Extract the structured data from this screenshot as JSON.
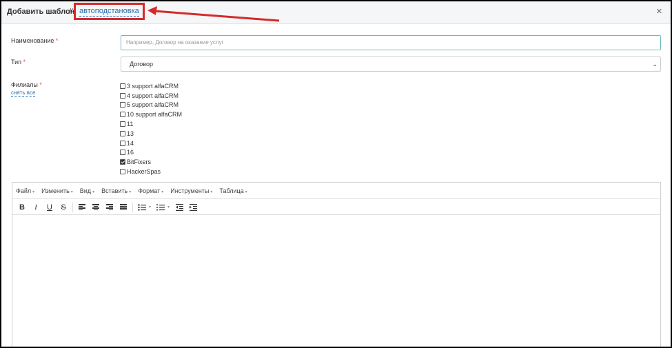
{
  "header": {
    "title": "Добавить шаблон",
    "separator": "//",
    "autofill_link": "автоподстановка",
    "close": "×"
  },
  "form": {
    "name_label": "Наименование",
    "required_mark": "*",
    "name_placeholder": "Например, Договор на оказание услуг",
    "type_label": "Тип",
    "type_value": "Договор",
    "branches_label": "Филиалы",
    "uncheck_all": "снять все",
    "branches": [
      {
        "label": "3 support alfaCRM",
        "checked": false
      },
      {
        "label": "4 support alfaCRM",
        "checked": false
      },
      {
        "label": "5 support alfaCRM",
        "checked": false
      },
      {
        "label": "10 support alfaCRM",
        "checked": false
      },
      {
        "label": "11",
        "checked": false
      },
      {
        "label": "13",
        "checked": false
      },
      {
        "label": "14",
        "checked": false
      },
      {
        "label": "16",
        "checked": false
      },
      {
        "label": "BitFixers",
        "checked": true
      },
      {
        "label": "HackerSpas",
        "checked": false
      }
    ]
  },
  "editor": {
    "menu": [
      "Файл",
      "Изменить",
      "Вид",
      "Вставить",
      "Формат",
      "Инструменты",
      "Таблица"
    ],
    "toolbar": {
      "bold": "B",
      "italic": "I",
      "underline": "U",
      "strike": "S"
    }
  },
  "colors": {
    "accent": "#2a6fb0",
    "highlight": "#d42a2a",
    "required": "#e74c3c"
  }
}
